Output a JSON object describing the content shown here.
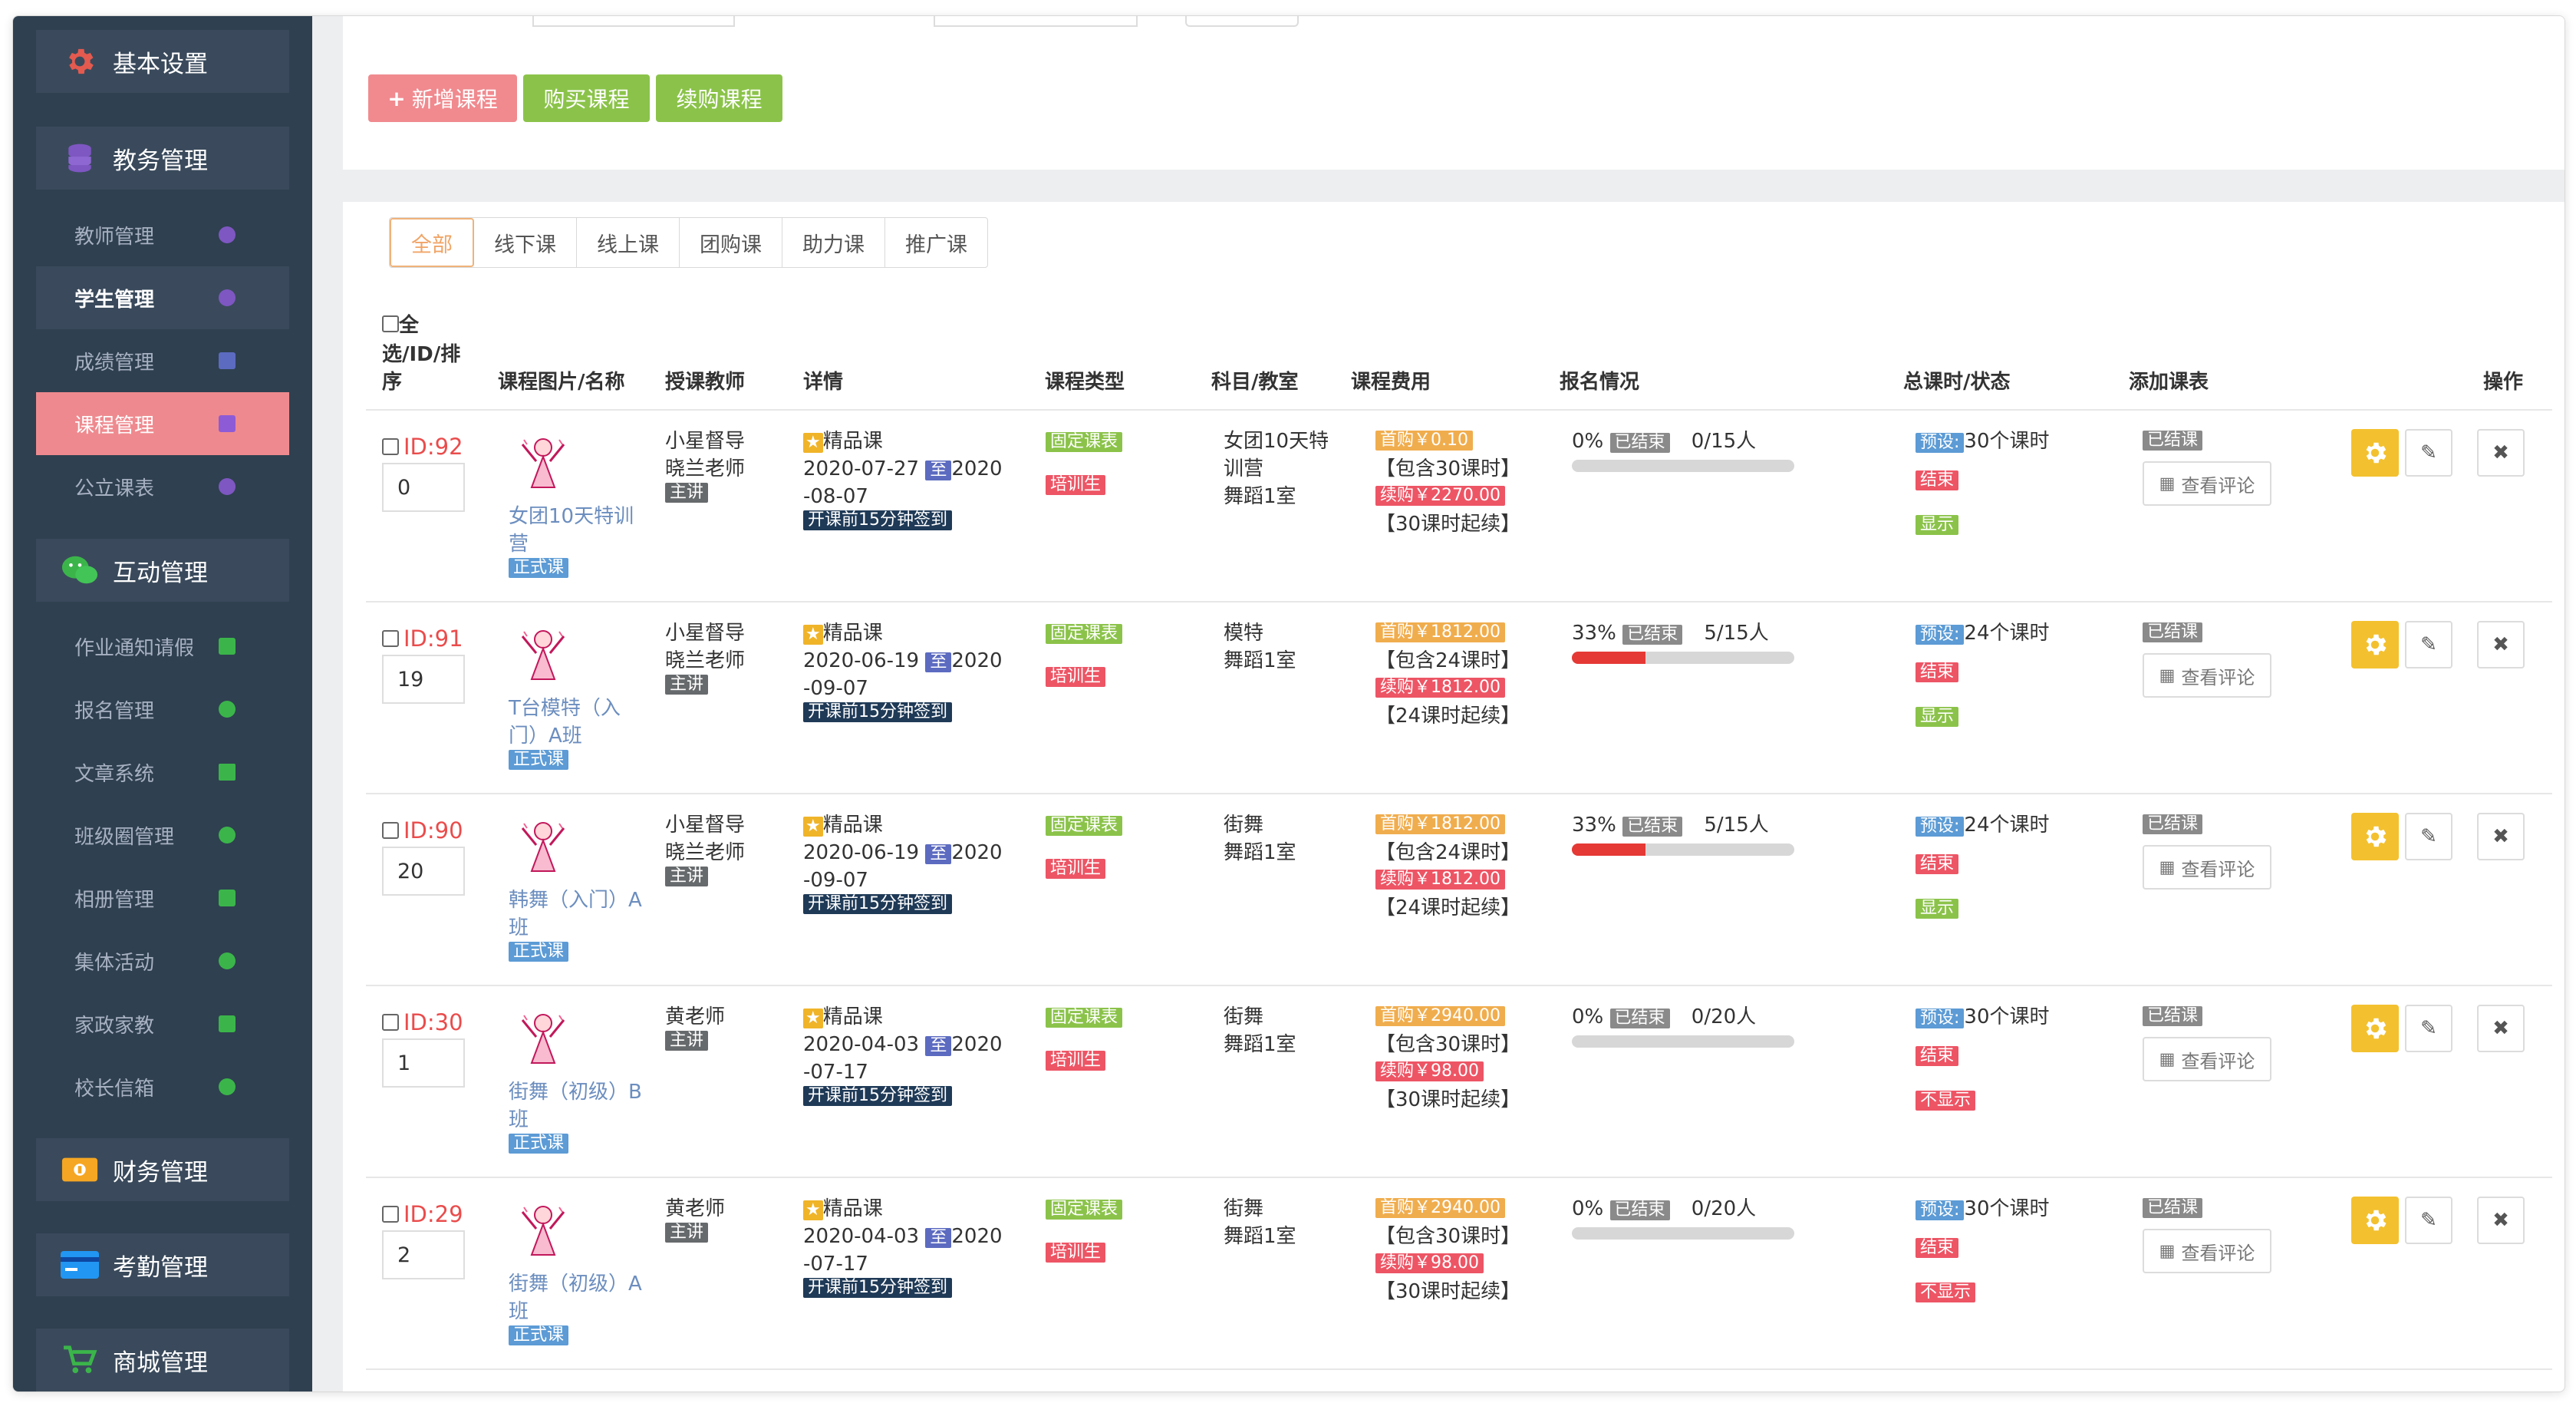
{
  "sidebar": {
    "basic_settings": "基本设置",
    "academic": {
      "label": "教务管理",
      "items": [
        {
          "label": "教师管理"
        },
        {
          "label": "学生管理"
        },
        {
          "label": "成绩管理"
        },
        {
          "label": "课程管理"
        },
        {
          "label": "公立课表"
        }
      ]
    },
    "interaction": {
      "label": "互动管理",
      "items": [
        {
          "label": "作业通知请假"
        },
        {
          "label": "报名管理"
        },
        {
          "label": "文章系统"
        },
        {
          "label": "班级圈管理"
        },
        {
          "label": "相册管理"
        },
        {
          "label": "集体活动"
        },
        {
          "label": "家政家教"
        },
        {
          "label": "校长信箱"
        }
      ]
    },
    "finance": "财务管理",
    "attendance": "考勤管理",
    "mall": "商城管理"
  },
  "toolbar": {
    "add_course": "新增课程",
    "buy_course": "购买课程",
    "renew_course": "续购课程"
  },
  "tabs": [
    "全部",
    "线下课",
    "线上课",
    "团购课",
    "助力课",
    "推广课"
  ],
  "columns": {
    "select": "全选/ID/排序",
    "select_line1": "全",
    "select_line2": "选/ID/排",
    "select_line3": "序",
    "image_name": "课程图片/名称",
    "teacher": "授课教师",
    "detail": "详情",
    "type": "课程类型",
    "subject": "科目/教室",
    "fee": "课程费用",
    "enroll": "报名情况",
    "hours": "总课时/状态",
    "schedule": "添加课表",
    "ops": "操作"
  },
  "common": {
    "formal_course": "正式课",
    "main_teacher": "主讲",
    "premium": "精品课",
    "to": "至",
    "checkin": "开课前15分钟签到",
    "fixed_schedule": "固定课表",
    "training": "培训生",
    "first_buy_prefix": "首购",
    "renew_prefix": "续购",
    "ended": "已结束",
    "preset": "预设:",
    "end": "结束",
    "show": "显示",
    "hide": "不显示",
    "class_ended": "已结课",
    "view_comments": "查看评论"
  },
  "rows": [
    {
      "id": "ID:92",
      "sort": "0",
      "name_l1": "女团10天特训",
      "name_l2": "营",
      "teacher_l1": "小星督导",
      "teacher_l2": "晓兰老师",
      "date_l1": "2020-07-27",
      "date_l2": "2020",
      "date_l3": "-08-07",
      "subject_l1": "女团10天特",
      "subject_l2": "训营",
      "subject_l3": "舞蹈1室",
      "first_price": "首购￥0.10",
      "includes": "【包含30课时】",
      "renew_price": "续购￥2270.00",
      "min_hours": "【30课时起续】",
      "percent": "0%",
      "enroll": "0/15人",
      "progress": 0,
      "hours": "30个课时",
      "visible": "显示"
    },
    {
      "id": "ID:91",
      "sort": "19",
      "name_l1": "T台模特（入",
      "name_l2": "门）A班",
      "teacher_l1": "小星督导",
      "teacher_l2": "晓兰老师",
      "date_l1": "2020-06-19",
      "date_l2": "2020",
      "date_l3": "-09-07",
      "subject_l1": "模特",
      "subject_l2": "舞蹈1室",
      "subject_l3": "",
      "first_price": "首购￥1812.00",
      "includes": "【包含24课时】",
      "renew_price": "续购￥1812.00",
      "min_hours": "【24课时起续】",
      "percent": "33%",
      "enroll": "5/15人",
      "progress": 0.33,
      "hours": "24个课时",
      "visible": "显示"
    },
    {
      "id": "ID:90",
      "sort": "20",
      "name_l1": "韩舞（入门）A",
      "name_l2": "班",
      "teacher_l1": "小星督导",
      "teacher_l2": "晓兰老师",
      "date_l1": "2020-06-19",
      "date_l2": "2020",
      "date_l3": "-09-07",
      "subject_l1": "街舞",
      "subject_l2": "舞蹈1室",
      "subject_l3": "",
      "first_price": "首购￥1812.00",
      "includes": "【包含24课时】",
      "renew_price": "续购￥1812.00",
      "min_hours": "【24课时起续】",
      "percent": "33%",
      "enroll": "5/15人",
      "progress": 0.33,
      "hours": "24个课时",
      "visible": "显示"
    },
    {
      "id": "ID:30",
      "sort": "1",
      "name_l1": "街舞（初级）B",
      "name_l2": "班",
      "teacher_l1": "黄老师",
      "teacher_l2": "",
      "date_l1": "2020-04-03",
      "date_l2": "2020",
      "date_l3": "-07-17",
      "subject_l1": "街舞",
      "subject_l2": "舞蹈1室",
      "subject_l3": "",
      "first_price": "首购￥2940.00",
      "includes": "【包含30课时】",
      "renew_price": "续购￥98.00",
      "min_hours": "【30课时起续】",
      "percent": "0%",
      "enroll": "0/20人",
      "progress": 0,
      "hours": "30个课时",
      "visible": "不显示"
    },
    {
      "id": "ID:29",
      "sort": "2",
      "name_l1": "街舞（初级）A",
      "name_l2": "班",
      "teacher_l1": "黄老师",
      "teacher_l2": "",
      "date_l1": "2020-04-03",
      "date_l2": "2020",
      "date_l3": "-07-17",
      "subject_l1": "街舞",
      "subject_l2": "舞蹈1室",
      "subject_l3": "",
      "first_price": "首购￥2940.00",
      "includes": "【包含30课时】",
      "renew_price": "续购￥98.00",
      "min_hours": "【30课时起续】",
      "percent": "0%",
      "enroll": "0/20人",
      "progress": 0,
      "hours": "30个课时",
      "visible": "不显示"
    }
  ],
  "colors": {
    "sidebar_bg": "#2f4050",
    "active_item": "#ee8a8f",
    "add_button": "#f08a8f",
    "green_button": "#8bc34a",
    "id_red": "#ea4c4c",
    "gear_yellow": "#f3c12f"
  }
}
